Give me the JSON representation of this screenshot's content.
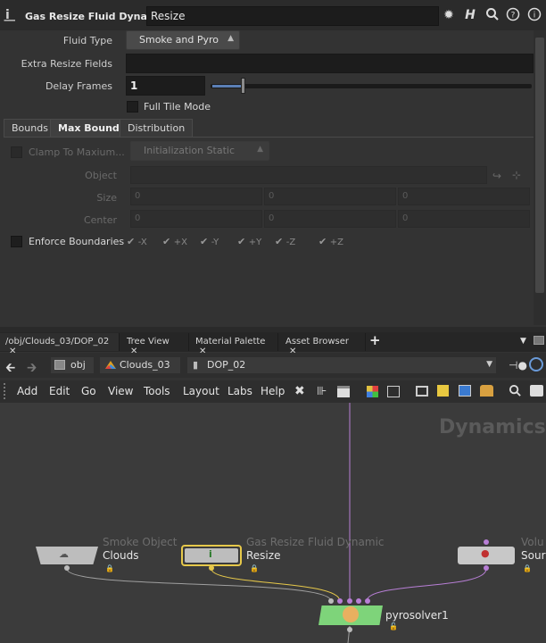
{
  "header": {
    "node_type_label": "Gas Resize Fluid Dynamic",
    "node_name": "Resize",
    "icons": [
      "gear-icon",
      "help-h-icon",
      "search-icon",
      "help-icon",
      "info-icon"
    ]
  },
  "params": {
    "fluid_type_label": "Fluid Type",
    "fluid_type_value": "Smoke and Pyro",
    "extra_resize_fields_label": "Extra Resize Fields",
    "extra_resize_fields_value": "",
    "delay_frames_label": "Delay Frames",
    "delay_frames_value": "1",
    "full_tile_mode_label": "Full Tile Mode"
  },
  "tabs": [
    {
      "label": "Bounds"
    },
    {
      "label": "Max Bounds"
    },
    {
      "label": "Distribution"
    }
  ],
  "max_bounds": {
    "clamp_label": "Clamp To Maxium...",
    "init_value": "Initialization Static",
    "object_label": "Object",
    "size_label": "Size",
    "size_values": [
      "0",
      "0",
      "0"
    ],
    "center_label": "Center",
    "center_values": [
      "0",
      "0",
      "0"
    ],
    "enforce_label": "Enforce Boundaries",
    "axes": [
      "-X",
      "+X",
      "-Y",
      "+Y",
      "-Z",
      "+Z"
    ]
  },
  "network_tabs": [
    {
      "label": "/obj/Clouds_03/DOP_02"
    },
    {
      "label": "Tree View"
    },
    {
      "label": "Material Palette"
    },
    {
      "label": "Asset Browser"
    }
  ],
  "breadcrumbs": [
    "obj",
    "Clouds_03",
    "DOP_02"
  ],
  "menu": [
    "Add",
    "Edit",
    "Go",
    "View",
    "Tools",
    "Layout",
    "Labs",
    "Help"
  ],
  "canvas": {
    "context_label": "Dynamics",
    "nodes": [
      {
        "type": "Smoke Object",
        "name": "Clouds"
      },
      {
        "type": "Gas Resize Fluid Dynamic",
        "name": "Resize"
      },
      {
        "type": "Volu",
        "name": "Sour"
      },
      {
        "type": "",
        "name": "pyrosolver1"
      }
    ]
  },
  "colors": {
    "accent_yellow": "#e6c84a",
    "solver_green": "#7ed47a",
    "wire_purple": "#b87fd6"
  }
}
